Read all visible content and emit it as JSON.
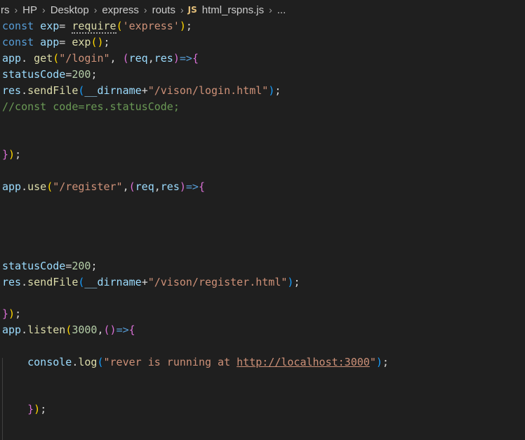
{
  "breadcrumb": {
    "items": [
      "rs",
      "HP",
      "Desktop",
      "express",
      "routs"
    ],
    "file_icon": "JS",
    "file_name": "html_rspns.js",
    "ellipsis": "..."
  },
  "code": {
    "l1": {
      "a": "const",
      "b": " exp",
      "c": "= ",
      "d": "require",
      "e": "(",
      "f": "'express'",
      "g": ")",
      "h": ";"
    },
    "l2": {
      "a": "const",
      "b": " app",
      "c": "= ",
      "d": "exp",
      "e": "()",
      "f": ";"
    },
    "l3": {
      "a": "app",
      "b": ". ",
      "c": "get",
      "d": "(",
      "e": "\"/login\"",
      "f": ", ",
      "g": "(",
      "h": "req",
      "i": ",",
      "j": "res",
      "k": ")",
      "l": "=>",
      "m": "{"
    },
    "l4": {
      "a": "statusCode",
      "b": "=",
      "c": "200",
      "d": ";"
    },
    "l5": {
      "a": "res",
      "b": ".",
      "c": "sendFile",
      "d": "(",
      "e": "__dirname",
      "f": "+",
      "g": "\"/vison/login.html\"",
      "h": ")",
      "i": ";"
    },
    "l6": {
      "a": "//const code=res.statusCode;"
    },
    "l7": {
      "a": "}",
      "b": ")",
      "c": ";"
    },
    "l8": {
      "a": "app",
      "b": ".",
      "c": "use",
      "d": "(",
      "e": "\"/register\"",
      "f": ",",
      "g": "(",
      "h": "req",
      "i": ",",
      "j": "res",
      "k": ")",
      "l": "=>",
      "m": "{"
    },
    "l9": {
      "a": "statusCode",
      "b": "=",
      "c": "200",
      "d": ";"
    },
    "l10": {
      "a": "res",
      "b": ".",
      "c": "sendFile",
      "d": "(",
      "e": "__dirname",
      "f": "+",
      "g": "\"/vison/register.html\"",
      "h": ")",
      "i": ";"
    },
    "l11": {
      "a": "}",
      "b": ")",
      "c": ";"
    },
    "l12": {
      "a": "app",
      "b": ".",
      "c": "listen",
      "d": "(",
      "e": "3000",
      "f": ",",
      "g": "()",
      "h": "=>",
      "i": "{"
    },
    "l13": {
      "a": "    ",
      "b": "console",
      "c": ".",
      "d": "log",
      "e": "(",
      "f": "\"rever is running at ",
      "g": "http://localhost:3000",
      "h": "\"",
      "i": ")",
      "j": ";"
    },
    "l14": {
      "a": "    ",
      "b": "}",
      "c": ")",
      "d": ";"
    }
  }
}
